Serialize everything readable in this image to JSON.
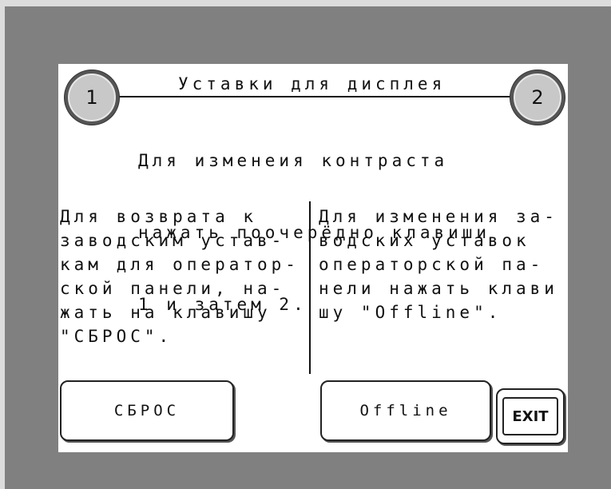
{
  "screen": {
    "title": "Уставки для дисплея",
    "intro": [
      "Для изменеия контраста",
      "нажать поочерёдно клавиши",
      "1 и затем 2."
    ],
    "key1_label": "1",
    "key2_label": "2",
    "left_text": [
      "Для возврата к",
      "заводским устав-",
      "кам для оператор-",
      "ской панели, на-",
      "жать на клавишу",
      "\"СБРОС\"."
    ],
    "right_text": [
      "Для изменения за-",
      "водских уставок",
      "операторской па-",
      "нели нажать клави",
      "шу \"Offline\"."
    ],
    "buttons": {
      "reset": "СБРОС",
      "offline": "Offline",
      "exit": "EXIT"
    }
  },
  "colors": {
    "bezel": "#808080",
    "screen_bg": "#ffffff",
    "key_fill": "#c8c8c8",
    "text": "#111111"
  }
}
